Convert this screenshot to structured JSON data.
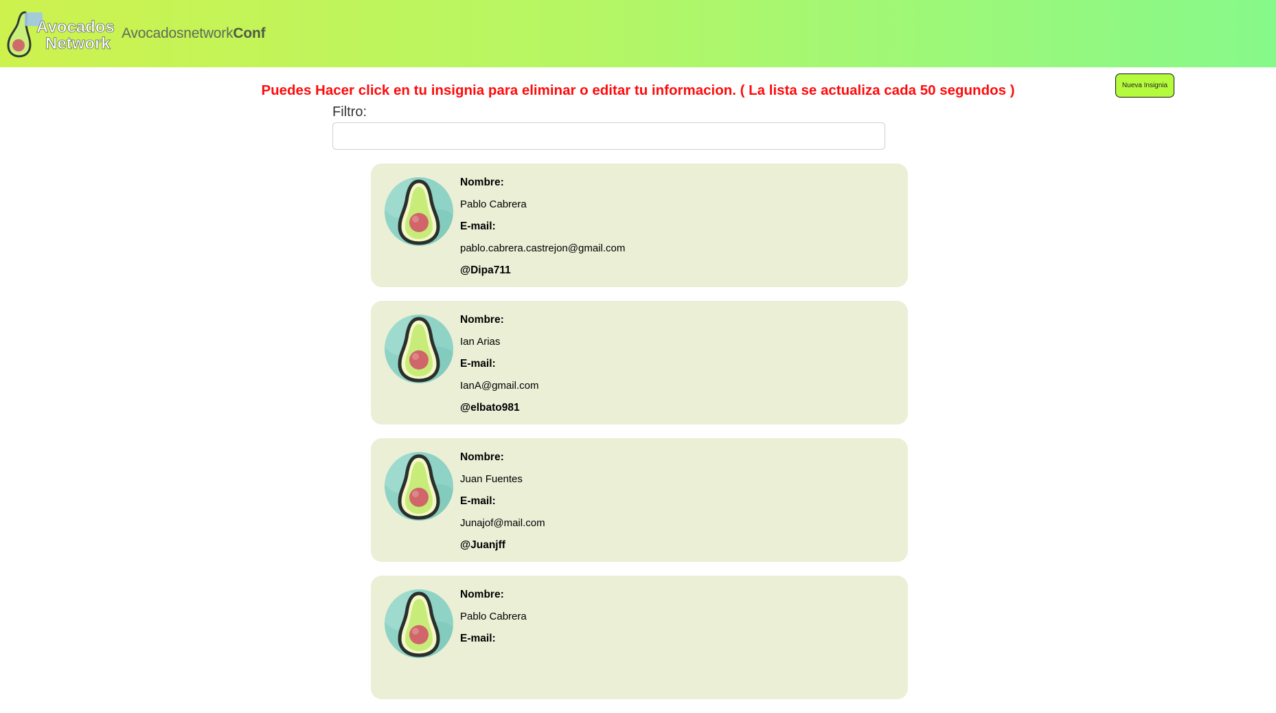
{
  "navbar": {
    "logo_text_line1": "Avocados",
    "logo_text_line2": "Network",
    "brand_light": "Avocadosnetwork",
    "brand_bold": "Conf"
  },
  "notice": "Puedes Hacer click en tu insignia para eliminar o editar tu informacion. ( La lista se actualiza cada 50 segundos )",
  "new_badge_button": "Nueva Insignia",
  "filter": {
    "label": "Filtro:",
    "value": ""
  },
  "labels": {
    "name": "Nombre:",
    "email": "E-mail:"
  },
  "badges": [
    {
      "name": "Pablo Cabrera",
      "email": "pablo.cabrera.castrejon@gmail.com",
      "twitter": "@Dipa711"
    },
    {
      "name": "Ian Arias",
      "email": "IanA@gmail.com",
      "twitter": "@elbato981"
    },
    {
      "name": "Juan Fuentes",
      "email": "Junajof@mail.com",
      "twitter": "@Juanjff"
    },
    {
      "name": "Pablo Cabrera",
      "email": "",
      "twitter": ""
    }
  ],
  "colors": {
    "notice": "#ff0a0a",
    "card_bg": "#eaefd6",
    "button_bg": "#b5fb3d"
  }
}
